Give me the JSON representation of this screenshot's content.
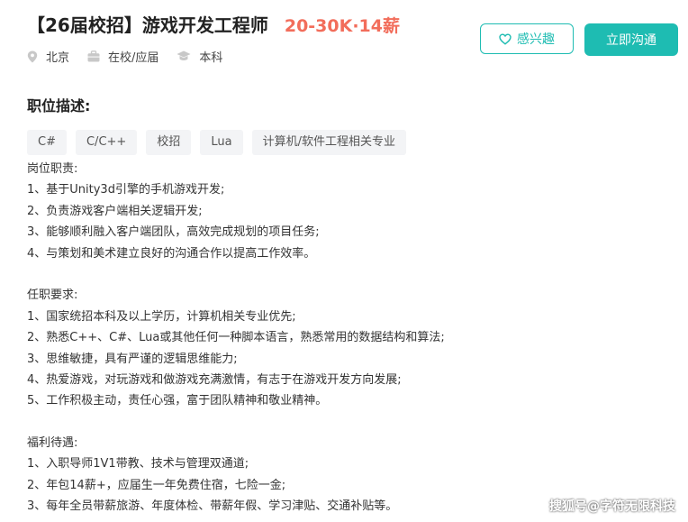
{
  "job": {
    "title": "【26届校招】游戏开发工程师",
    "salary": "20-30K·14薪",
    "location": "北京",
    "status": "在校/应届",
    "education": "本科"
  },
  "actions": {
    "interest_label": "感兴趣",
    "chat_label": "立即沟通"
  },
  "section": {
    "title": "职位描述:"
  },
  "tags": [
    "C#",
    "C/C++",
    "校招",
    "Lua",
    "计算机/软件工程相关专业"
  ],
  "description": {
    "duties_heading": "岗位职责:",
    "duties": [
      "1、基于Unity3d引擎的手机游戏开发;",
      "2、负责游戏客户端相关逻辑开发;",
      "3、能够顺利融入客户端团队，高效完成规划的项目任务;",
      "4、与策划和美术建立良好的沟通合作以提高工作效率。"
    ],
    "requirements_heading": "任职要求:",
    "requirements": [
      "1、国家统招本科及以上学历，计算机相关专业优先;",
      "2、熟悉C++、C#、Lua或其他任何一种脚本语言，熟悉常用的数据结构和算法;",
      "3、思维敏捷，具有严谨的逻辑思维能力;",
      "4、热爱游戏，对玩游戏和做游戏充满激情，有志于在游戏开发方向发展;",
      "5、工作积极主动，责任心强，富于团队精神和敬业精神。"
    ],
    "benefits_heading": "福利待遇:",
    "benefits": [
      "1、入职导师1V1带教、技术与管理双通道;",
      "2、年包14薪+，应届生一年免费住宿，七险一金;",
      "3、每年全员带薪旅游、年度体检、带薪年假、学习津贴、交通补贴等。"
    ]
  },
  "watermark": "搜狐号@字符无限科技",
  "colors": {
    "accent": "#1ebcb2",
    "salary": "#f26d5b",
    "tag_bg": "#f3f4f6"
  },
  "icons": {
    "location": "location-pin-icon",
    "status": "briefcase-icon",
    "education": "graduation-cap-icon",
    "interest": "heart-icon"
  }
}
